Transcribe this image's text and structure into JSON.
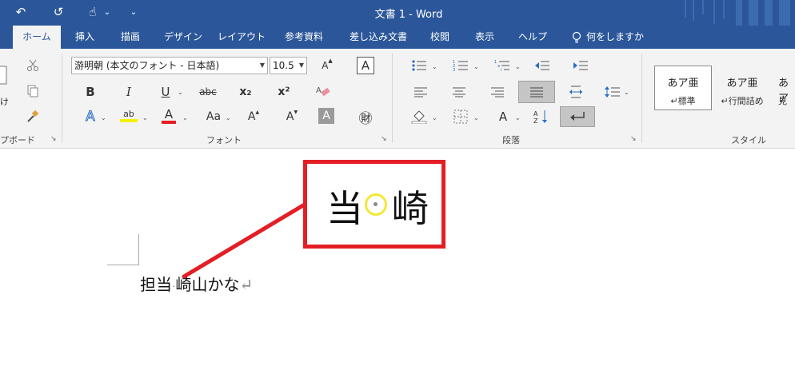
{
  "window": {
    "title": "文書 1  -  Word"
  },
  "qat": {
    "undo": "↶",
    "redo": "↺",
    "touch": "☝",
    "touch_arrow": "⌄",
    "customize": "⌄"
  },
  "tabs": [
    "ホーム",
    "挿入",
    "描画",
    "デザイン",
    "レイアウト",
    "参考資料",
    "差し込み文書",
    "校閲",
    "表示",
    "ヘルプ"
  ],
  "tell_me": {
    "icon": "lightbulb-icon",
    "label": "何をしますか"
  },
  "clipboard": {
    "label": "プボード",
    "partial_label": "け"
  },
  "font": {
    "label": "フォント",
    "font_name": "游明朝 (本文のフォント - 日本語)",
    "font_size": "10.5",
    "grow": "A",
    "shrink": "A",
    "bold": "B",
    "italic": "I",
    "underline": "U",
    "strike": "abc",
    "sub": "x₂",
    "sup": "x²",
    "highlight": "ab",
    "font_color": "A",
    "change_case": "Aa",
    "enclose": "㊖",
    "phonetic": "亜"
  },
  "paragraph": {
    "label": "段落"
  },
  "styles": {
    "label": "スタイル",
    "items": [
      {
        "sample": "あア亜",
        "name": "↵標準"
      },
      {
        "sample": "あア亜",
        "name": "↵行間詰め"
      },
      {
        "sample": "あア",
        "name": "見出"
      }
    ]
  },
  "document": {
    "text_before": "担当",
    "middle_dot": "·",
    "text_after": "崎山かな",
    "paragraph_mark": "↵"
  },
  "zoom": {
    "left": "当",
    "right": "崎"
  },
  "colors": {
    "accent": "#2b579a",
    "annotation": "#e41e25",
    "highlight_circle": "#f3e834"
  }
}
